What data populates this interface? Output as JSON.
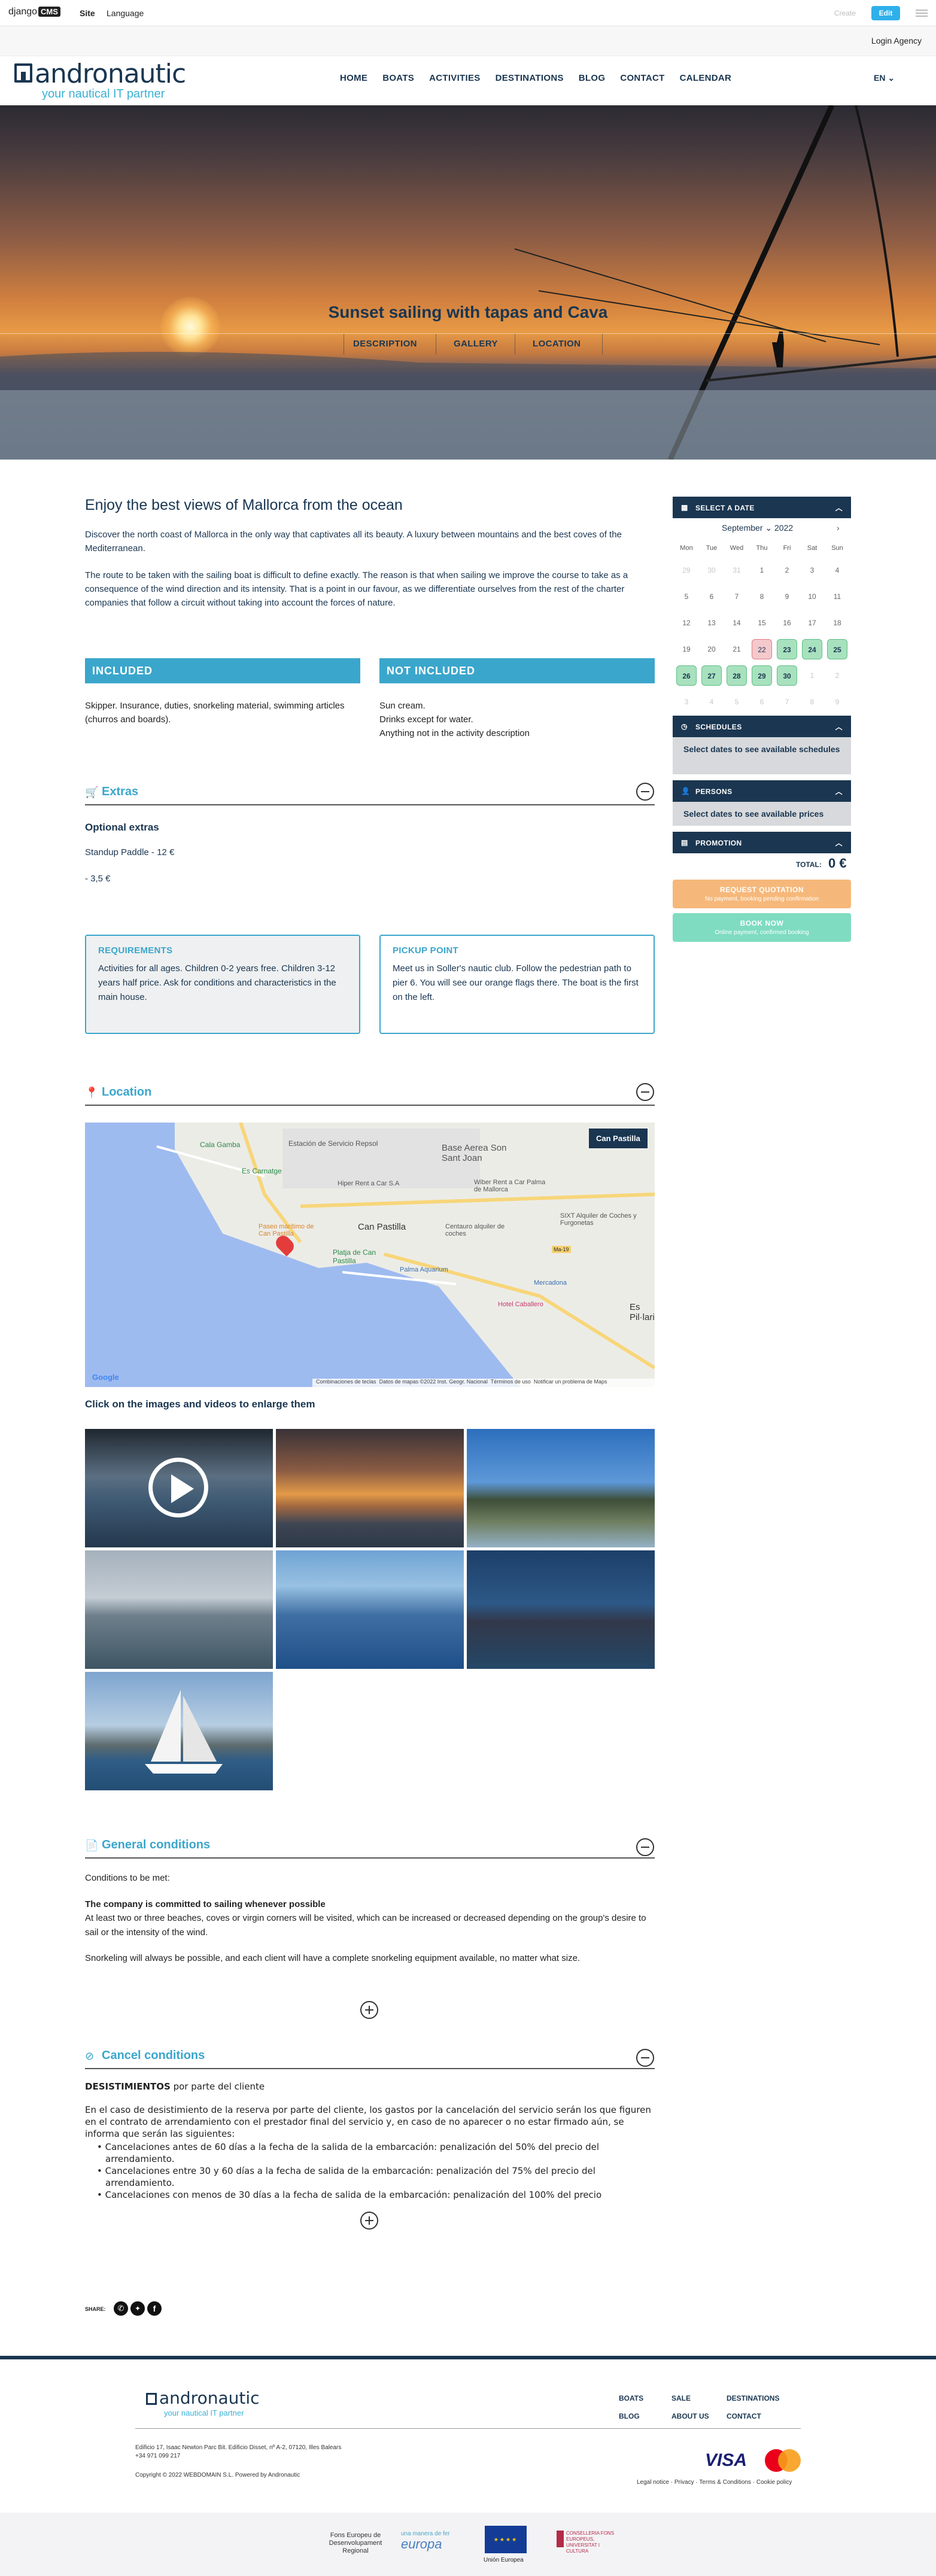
{
  "cms": {
    "logo": "django",
    "logo_badge": "CMS",
    "site": "Site",
    "language": "Language",
    "create": "Create",
    "edit": "Edit"
  },
  "login": {
    "label": "Login Agency"
  },
  "brand": {
    "name": "andronautic",
    "tagline": "your nautical IT partner"
  },
  "nav": {
    "items": [
      "HOME",
      "BOATS",
      "ACTIVITIES",
      "DESTINATIONS",
      "BLOG",
      "CONTACT",
      "CALENDAR"
    ],
    "language": "EN"
  },
  "hero": {
    "title": "Sunset sailing with tapas and Cava",
    "tabs": [
      "DESCRIPTION",
      "GALLERY",
      "LOCATION"
    ]
  },
  "main": {
    "heading": "Enjoy the best views of Mallorca from the ocean",
    "para1": "Discover the north coast of Mallorca in the only way that captivates all its beauty. A luxury between mountains and the best coves of the Mediterranean.",
    "para2": "The route to be taken with the sailing boat is difficult to define exactly. The reason is that when sailing we improve the course to take as a consequence of the wind direction and its intensity. That is a point in our favour, as we differentiate ourselves from the rest of the charter companies that follow a circuit without taking into account the forces of nature.",
    "included_title": "INCLUDED",
    "included_text": "Skipper. Insurance, duties, snorkeling material, swimming articles (churros and boards).",
    "not_included_title": "NOT INCLUDED",
    "not_included_lines": [
      "Sun cream.",
      "Drinks except for water.",
      "Anything not in the activity description"
    ]
  },
  "extras": {
    "title": "Extras",
    "subtitle": "Optional extras",
    "item1": "Standup Paddle - 12 €",
    "item2": "- 3,5 €"
  },
  "requirements": {
    "title": "REQUIREMENTS",
    "text": "Activities for all ages. Children 0-2 years free. Children 3-12 years half price. Ask for conditions and characteristics in the main house."
  },
  "pickup": {
    "title": "PICKUP POINT",
    "text": "Meet us in Soller's nautic club. Follow the pedestrian path to pier 6. You will see our orange flags there. The boat is the first on the left."
  },
  "location": {
    "title": "Location",
    "map_label": "Can Pastilla",
    "places": [
      "Estación de Servicio Repsol",
      "Base Aerea Son Sant Joan",
      "Cala Gamba",
      "Es Carnatge",
      "Hiper Rent a Car S.A",
      "Wiber Rent a Car Palma de Mallorca",
      "Can Pastilla",
      "Centauro alquiler de coches",
      "SIXT Alquiler de Coches y Furgonetas",
      "Paseo marítimo de Can Pastilla",
      "Platja de Can Pastilla",
      "Palma Aquarium",
      "Mercadona",
      "Hotel Caballero",
      "Es Pil·lari",
      "Ma-19"
    ],
    "footer_items": [
      "Combinaciones de teclas",
      "Datos de mapas ©2022 Inst. Geogr. Nacional",
      "Términos de uso",
      "Notificar un problema de Maps"
    ],
    "google": "Google",
    "gallery_caption": "Click on the images and videos to enlarge them"
  },
  "general": {
    "title": "General conditions",
    "intro": "Conditions to be met:",
    "bold": "The company is committed to sailing whenever possible",
    "text1": "At least two or three beaches, coves or virgin corners will be visited, which can be increased or decreased depending on the group's desire to sail or the intensity of the wind.",
    "text2": "Snorkeling will always be possible, and each client will have a complete snorkeling equipment available, no matter what size."
  },
  "cancel": {
    "title": "Cancel conditions",
    "heading_bold": "DESISTIMIENTOS",
    "heading_rest": " por parte del cliente",
    "intro": "En el caso de desistimiento de la reserva por parte del cliente, los gastos por la cancelación del servicio serán los que figuren en el contrato de arrendamiento con el prestador final del servicio y, en caso de no aparecer o no estar firmado aún, se informa que serán las siguientes:",
    "items": [
      "Cancelaciones antes de 60 días a la fecha de la salida de la embarcación: penalización del 50% del precio del arrendamiento.",
      "Cancelaciones entre 30 y 60 días a la fecha de salida de la embarcación: penalización del 75% del precio del arrendamiento.",
      "Cancelaciones con menos de 30 días a la fecha de salida de la embarcación: penalización del 100% del precio"
    ]
  },
  "share": {
    "label": "SHARE:"
  },
  "sidebar": {
    "select_date": "SELECT A DATE",
    "month": "September",
    "year": "2022",
    "weekdays": [
      "Mon",
      "Tue",
      "Wed",
      "Thu",
      "Fri",
      "Sat",
      "Sun"
    ],
    "days": [
      [
        "29",
        "30",
        "31",
        "1",
        "2",
        "3",
        "4"
      ],
      [
        "5",
        "6",
        "7",
        "8",
        "9",
        "10",
        "11"
      ],
      [
        "12",
        "13",
        "14",
        "15",
        "16",
        "17",
        "18"
      ],
      [
        "19",
        "20",
        "21",
        "22",
        "23",
        "24",
        "25"
      ],
      [
        "26",
        "27",
        "28",
        "29",
        "30",
        "1",
        "2"
      ],
      [
        "3",
        "4",
        "5",
        "6",
        "7",
        "8",
        "9"
      ]
    ],
    "schedules": "SCHEDULES",
    "schedules_msg": "Select dates to see available schedules",
    "persons": "PERSONS",
    "persons_msg": "Select dates to see available prices",
    "promotion": "PROMOTION",
    "total_label": "TOTAL:",
    "total_value": "0 €",
    "request_title": "REQUEST QUOTATION",
    "request_sub": "No payment, booking pending confirmation",
    "book_title": "BOOK NOW",
    "book_sub": "Online payment, confirmed booking",
    "colors": {
      "navy": "#1a3651",
      "accent": "#3ba6cc",
      "request": "#f6b87a",
      "book": "#7fdcc0"
    }
  },
  "footer": {
    "links": [
      "BOATS",
      "SALE",
      "DESTINATIONS",
      "BLOG",
      "ABOUT US",
      "CONTACT"
    ],
    "address": "Edificio 17, Isaac Newton Parc Bit. Edificio Disset, nº A-2, 07120, Illes Balears",
    "phone": "+34 971 099 217",
    "copyright": "Copyright © 2022 WEBDOMAIN S.L. Powered by Andronautic",
    "legal": "Legal notice · Privacy · Terms & Conditions · Cookie policy",
    "visa": "VISA"
  },
  "eu": {
    "feder": "Fons Europeu de Desenvolupament Regional",
    "europa_small": "una manera de fer",
    "europa": "europa",
    "union": "Unión Europea",
    "conselleria": "CONSELLERIA FONS EUROPEUS, UNIVERSITAT I CULTURA"
  }
}
